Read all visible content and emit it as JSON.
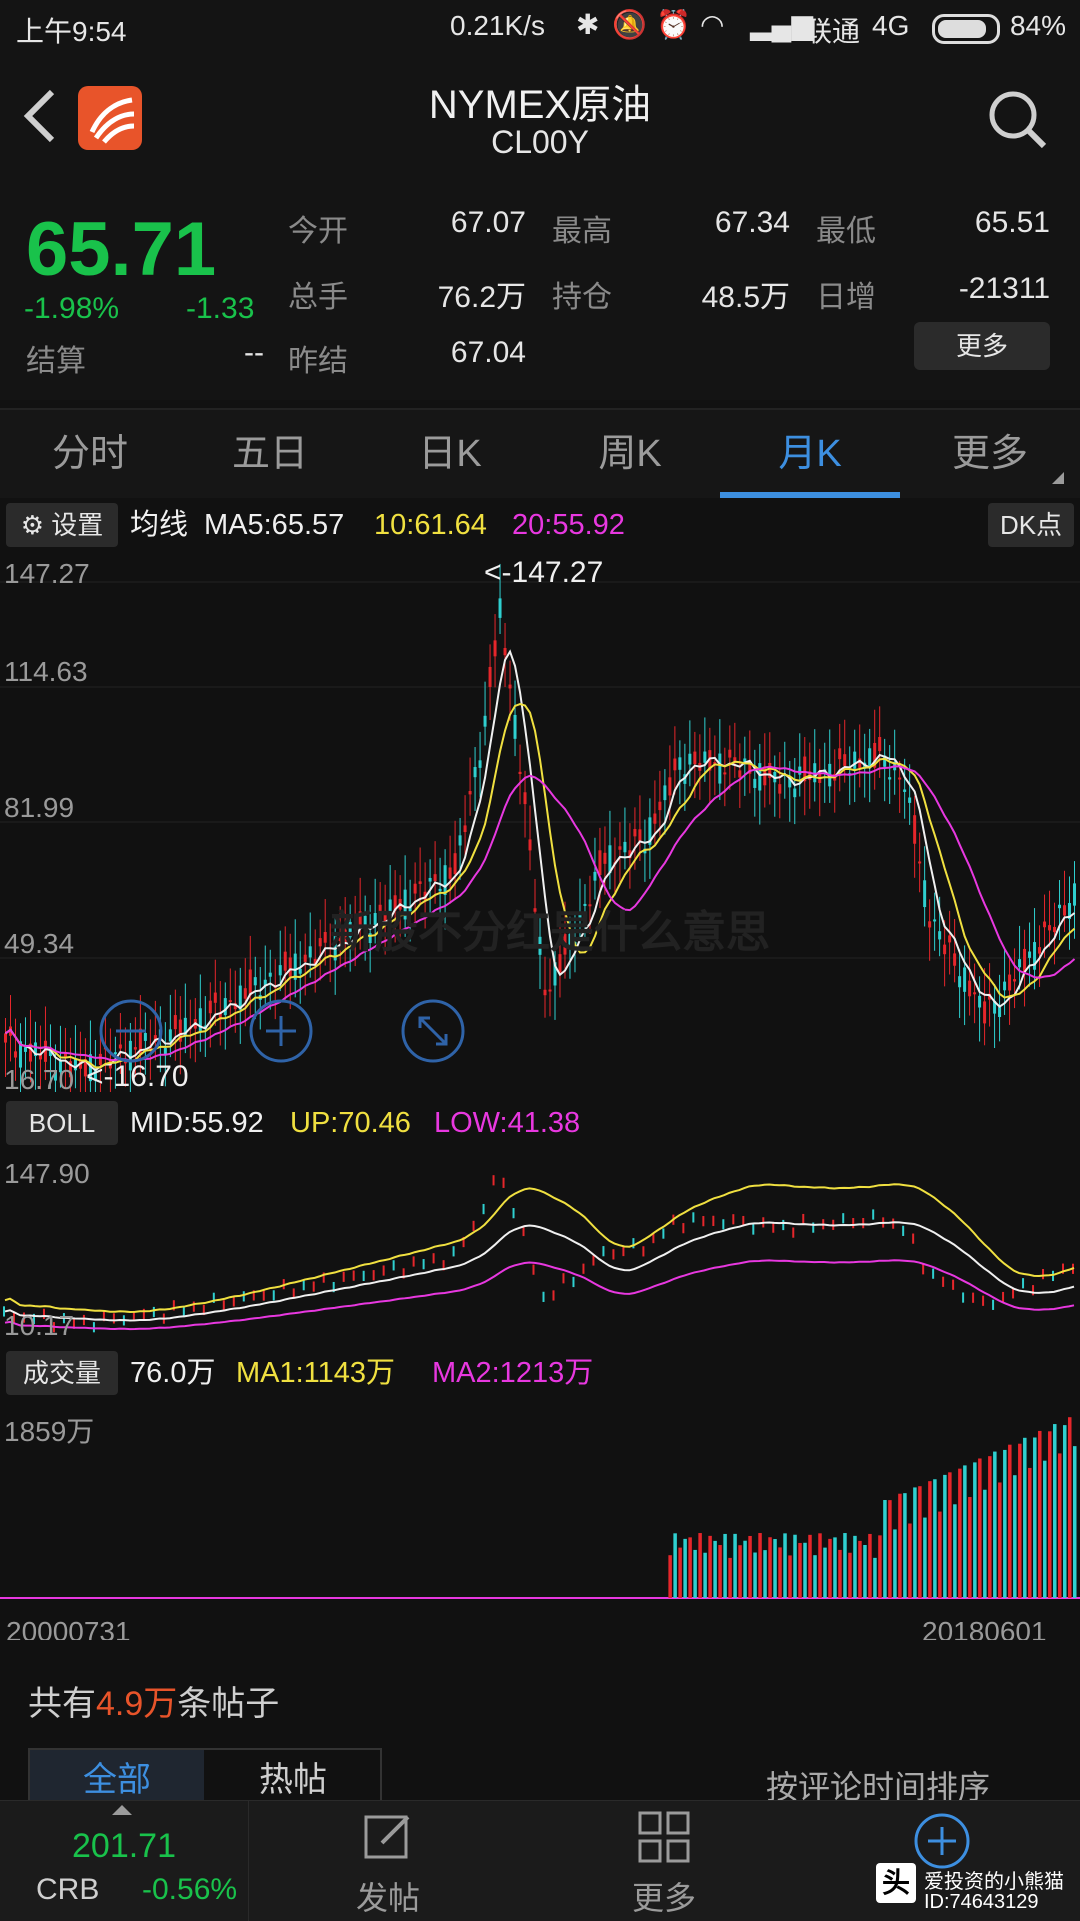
{
  "status": {
    "time": "上午9:54",
    "network_speed": "0.21K/s",
    "carrier": "联通",
    "signal_type": "4G",
    "battery": "84%"
  },
  "header": {
    "title": "NYMEX原油",
    "code": "CL00Y"
  },
  "quote": {
    "price": "65.71",
    "change_pct": "-1.98%",
    "change": "-1.33",
    "settle_label": "结算",
    "settle_value": "--",
    "open_label": "今开",
    "open_value": "67.07",
    "high_label": "最高",
    "high_value": "67.34",
    "low_label": "最低",
    "low_value": "65.51",
    "volume_label": "总手",
    "volume_value": "76.2万",
    "oi_label": "持仓",
    "oi_value": "48.5万",
    "daily_inc_label": "日增",
    "daily_inc_value": "-21311",
    "prev_settle_label": "昨结",
    "prev_settle_value": "67.04",
    "more_label": "更多"
  },
  "tabs": [
    "分时",
    "五日",
    "日K",
    "周K",
    "月K",
    "更多"
  ],
  "active_tab": 4,
  "ma_bar": {
    "settings_label": "设置",
    "ma_label": "均线",
    "ma5": "MA5:65.57",
    "ma10": "10:61.64",
    "ma20": "20:55.92",
    "dk_label": "DK点"
  },
  "kline": {
    "ticks": [
      "147.27",
      "114.63",
      "81.99",
      "49.34",
      "16.70"
    ],
    "max_label": "<-147.27",
    "min_label": "<-16.70"
  },
  "boll_bar": {
    "label": "BOLL",
    "mid": "MID:55.92",
    "up": "UP:70.46",
    "low": "LOW:41.38",
    "ticks": [
      "147.90",
      "10.17"
    ]
  },
  "vol_bar": {
    "label": "成交量",
    "vol": "76.0万",
    "ma1": "MA1:1143万",
    "ma2": "MA2:1213万",
    "tick": "1859万"
  },
  "dates": {
    "start": "20000731",
    "end": "20180601"
  },
  "posts": {
    "prefix": "共有",
    "count": "4.9万",
    "suffix": "条帖子",
    "tab_all": "全部",
    "tab_hot": "热帖",
    "sort": "按评论时间排序"
  },
  "bottom": {
    "crb_value": "201.71",
    "crb_label": "CRB",
    "crb_change": "-0.56%",
    "post_label": "发帖",
    "more_label": "更多"
  },
  "watermark": {
    "text": "新股不分红是什么意思",
    "brand": "爱投资的小熊猫",
    "id": "ID:74643129"
  },
  "colors": {
    "up": "#e6262b",
    "down": "#19c24b",
    "accent": "#3d8fe0",
    "ma5": "#f0f0f0",
    "ma10": "#f0e040",
    "ma20": "#e838e0"
  }
}
